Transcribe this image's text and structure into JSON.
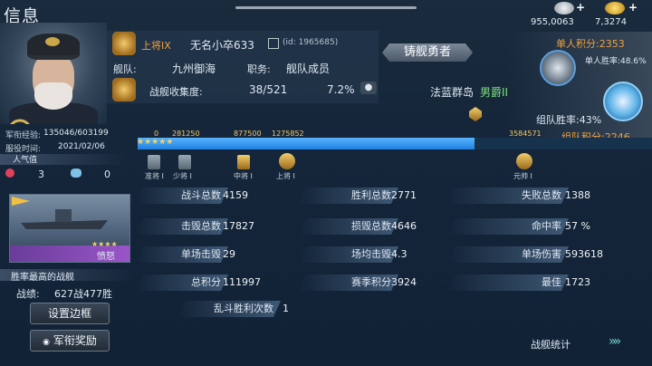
{
  "header": {
    "title": "信息",
    "silver": "955,0063",
    "gold": "7,3274",
    "plus": "+"
  },
  "player": {
    "rank": "上将IX",
    "name": "无名小卒633",
    "id": "(id: 1965685)",
    "fleet_label": "舰队:",
    "fleet": "九州御海",
    "role_label": "职务:",
    "role": "舰队成员",
    "collect_label": "战舰收集度:",
    "collect": "38/521",
    "collect_pct": "7.2%",
    "title_badge": "铸舰勇者",
    "location": "法蓝群岛",
    "peerage": "男爵II"
  },
  "scores": {
    "single_label": "单人积分:2353",
    "single_win": "单人胜率:48.6%",
    "team_win": "组队胜率:43%",
    "team_score": "组队积分:2246"
  },
  "exp": {
    "label": "军衔经验:",
    "value": "135046/603199",
    "date_label": "服役时间:",
    "date": "2021/02/06",
    "pct": 0.655,
    "ticks": [
      "0",
      "281250",
      "877500",
      "1275852",
      "3584571"
    ]
  },
  "ranks": [
    "准将 I",
    "少将 I",
    "中将 I",
    "上将 I",
    "元帅 I"
  ],
  "stars": "★★★★★",
  "popularity": {
    "label": "人气值",
    "likes": "3",
    "dislikes": "0"
  },
  "ship": {
    "stars": "★★★★",
    "name": "愤怒"
  },
  "best": {
    "label": "胜率最高的战舰",
    "record_label": "战绩:",
    "record": "627战477胜"
  },
  "buttons": {
    "frame": "设置边框",
    "honor": "军衔奖励",
    "stats": "战舰统计"
  },
  "stats": [
    {
      "l": "战斗总数",
      "v": "4159"
    },
    {
      "l": "胜利总数",
      "v": "2771"
    },
    {
      "l": "失败总数",
      "v": "1388"
    },
    {
      "l": "击毁总数",
      "v": "17827"
    },
    {
      "l": "损毁总数",
      "v": "4646"
    },
    {
      "l": "命中率",
      "v": "57 %"
    },
    {
      "l": "单场击毁",
      "v": "29"
    },
    {
      "l": "场均击毁",
      "v": "4.3"
    },
    {
      "l": "单场伤害",
      "v": "593618"
    },
    {
      "l": "总积分",
      "v": "111997"
    },
    {
      "l": "赛季积分",
      "v": "3924"
    },
    {
      "l": "最佳",
      "v": "1723"
    },
    {
      "l": "乱斗胜利次数",
      "v": "1"
    }
  ]
}
